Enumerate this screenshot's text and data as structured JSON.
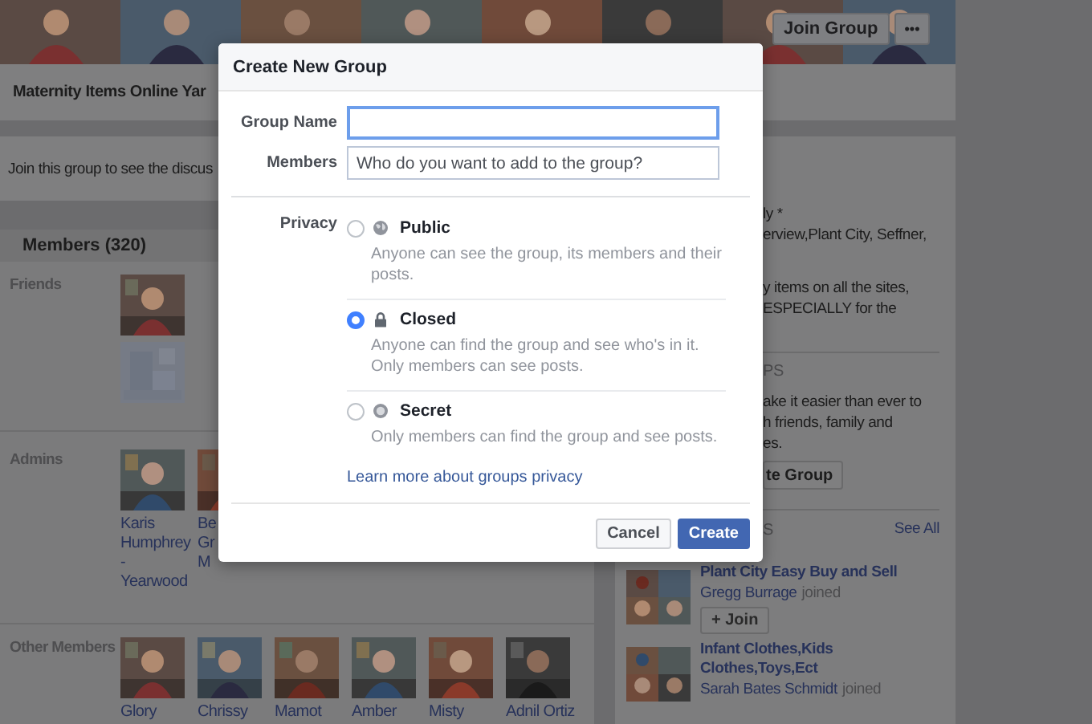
{
  "cover": {
    "join_button": "Join Group",
    "more_button": "•••"
  },
  "group_title": "Maternity Items Online Yar",
  "join_notice": "Join this group to see the discus",
  "members": {
    "heading": "Members (320)",
    "sections": [
      {
        "label": "Friends",
        "people": [
          {
            "kind": "picture"
          },
          {
            "kind": "blurred"
          }
        ]
      },
      {
        "label": "Admins",
        "people": [
          {
            "kind": "picture",
            "name_lines": [
              "Karis",
              "Humphrey",
              "-",
              "Yearwood"
            ]
          },
          {
            "kind": "picture",
            "name_lines": [
              "Be",
              "Gr",
              "M"
            ]
          }
        ]
      },
      {
        "label": "Other Members",
        "people": [
          {
            "kind": "picture",
            "name_lines": [
              "Glory"
            ]
          },
          {
            "kind": "picture",
            "name_lines": [
              "Chrissy"
            ]
          },
          {
            "kind": "picture",
            "name_lines": [
              "Mamot"
            ]
          },
          {
            "kind": "picture",
            "name_lines": [
              "Amber"
            ]
          },
          {
            "kind": "picture",
            "name_lines": [
              "Misty"
            ]
          },
          {
            "kind": "picture",
            "name_lines": [
              "Adnil Ortiz"
            ]
          }
        ]
      }
    ]
  },
  "about": {
    "paragraphs": [
      [
        "ly *",
        "erview,Plant City, Seffner,"
      ],
      [
        "y items on all the sites,",
        "ESPECIALLY for the"
      ]
    ]
  },
  "create_promo": {
    "heading": "PS",
    "lines": [
      "ake it easier than ever to",
      "h friends, family and",
      "es."
    ],
    "button": "te Group"
  },
  "suggested": {
    "heading": "S",
    "see_all": "See All",
    "groups": [
      {
        "title": "Plant City Easy Buy and Sell",
        "member": "Gregg Burrage",
        "action": "joined",
        "join_button": "+ Join"
      },
      {
        "title": "Infant Clothes,Kids Clothes,Toys,Ect",
        "member": "Sarah Bates Schmidt",
        "action": "joined"
      }
    ]
  },
  "dialog": {
    "title": "Create New Group",
    "fields": [
      {
        "label": "Group Name",
        "focused": true
      },
      {
        "label": "Members",
        "placeholder": "Who do you want to add to the group?",
        "focused": false
      }
    ],
    "privacy": {
      "label": "Privacy",
      "options": [
        {
          "kind": "public",
          "title": "Public",
          "description": "Anyone can see the group, its members and their posts.",
          "selected": false
        },
        {
          "kind": "closed",
          "title": "Closed",
          "description": "Anyone can find the group and see who's in it. Only members can see posts.",
          "selected": true
        },
        {
          "kind": "secret",
          "title": "Secret",
          "description": "Only members can find the group and see posts.",
          "selected": false
        }
      ],
      "link": "Learn more about groups privacy"
    },
    "buttons": {
      "cancel": "Cancel",
      "create": "Create"
    }
  }
}
